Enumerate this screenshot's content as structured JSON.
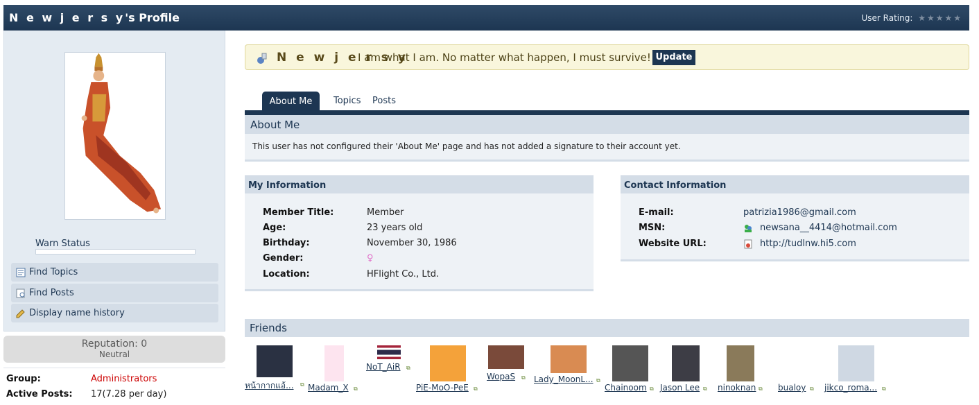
{
  "header": {
    "name_spaced": "N e w j e r s y",
    "title_suffix": "'s Profile",
    "rating_label": "User Rating:",
    "rating_stars": "★★★★★",
    "rating_value": 0
  },
  "sidebar": {
    "warn_label": "Warn Status",
    "warn_level": 1.0,
    "links": [
      {
        "label": "Find Topics",
        "icon": "topics-icon"
      },
      {
        "label": "Find Posts",
        "icon": "posts-icon"
      },
      {
        "label": "Display name history",
        "icon": "history-icon"
      }
    ],
    "reputation": {
      "label": "Reputation: 0",
      "sub": "Neutral"
    },
    "stats": [
      {
        "label": "Group:",
        "value": "Administrators"
      },
      {
        "label": "Active Posts:",
        "value": "17(7.28 per day)"
      }
    ]
  },
  "status": {
    "name": "N e w j e r s y",
    "message": "I am what I am. No matter what happen, I must survive!!!",
    "update_label": "Update"
  },
  "tabs": [
    "About Me",
    "Topics",
    "Posts"
  ],
  "about": {
    "title": "About Me",
    "body": "This user has not configured their 'About Me' page and has not added a signature to their account yet."
  },
  "my_info": {
    "title": "My Information",
    "rows": [
      {
        "label": "Member Title:",
        "value": "Member"
      },
      {
        "label": "Age:",
        "value": "23 years old"
      },
      {
        "label": "Birthday:",
        "value": "November 30, 1986"
      },
      {
        "label": "Gender:",
        "value": "♀"
      },
      {
        "label": "Location:",
        "value": "HFlight Co., Ltd."
      }
    ]
  },
  "contact": {
    "title": "Contact Information",
    "rows": [
      {
        "label": "E-mail:",
        "value": "patrizia1986@gmail.com"
      },
      {
        "label": "MSN:",
        "value": "newsana__4414@hotmail.com"
      },
      {
        "label": "Website URL:",
        "value": "http://tudlnw.hi5.com"
      }
    ]
  },
  "friends": {
    "title": "Friends",
    "list": [
      {
        "name": "หน้ากากแอ้..."
      },
      {
        "name": "Madam_X"
      },
      {
        "name": "NoT_AiR"
      },
      {
        "name": "PiE-MoO-PeE"
      },
      {
        "name": "WopaS"
      },
      {
        "name": "Lady_MoonL..."
      },
      {
        "name": "Chainoom"
      },
      {
        "name": "Jason Lee"
      },
      {
        "name": "ninoknan"
      },
      {
        "name": "bualoy"
      },
      {
        "name": "jikco_roma..."
      }
    ]
  },
  "colors": {
    "accent": "#1d3652",
    "panel": "#d4dde7",
    "status_bg": "#f9f6dc",
    "group": "#cc0000"
  }
}
